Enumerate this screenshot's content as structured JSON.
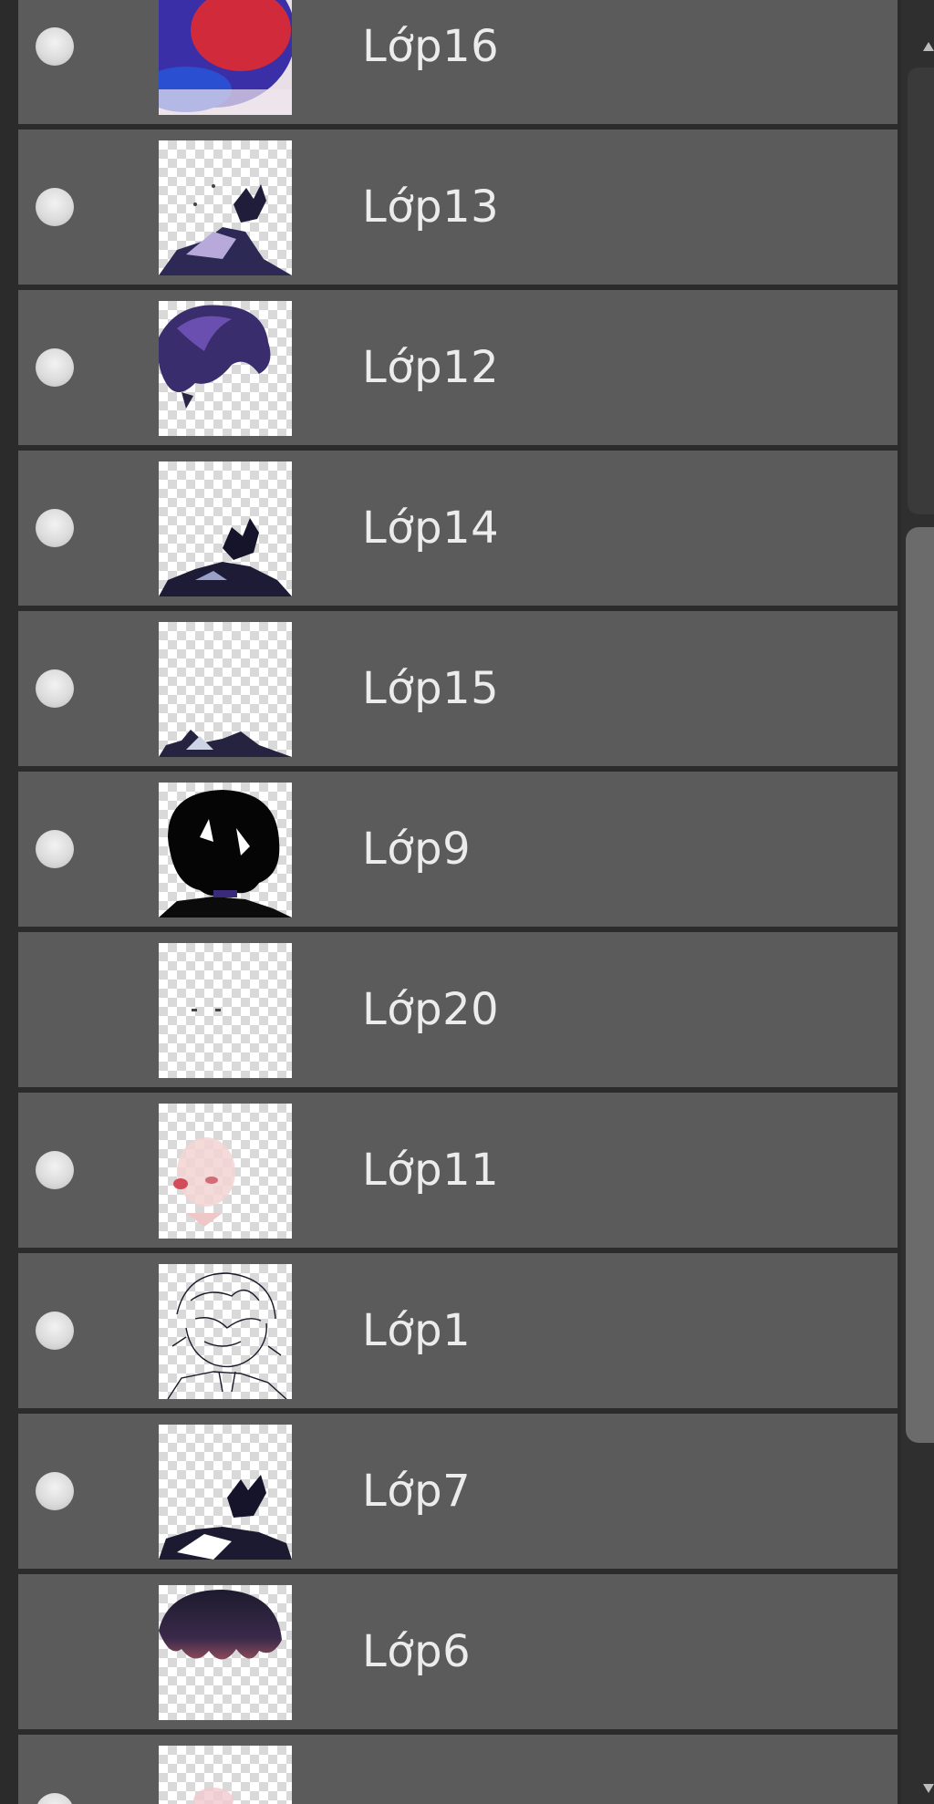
{
  "layers": [
    {
      "name": "Lớp16",
      "visible": true
    },
    {
      "name": "Lớp13",
      "visible": true
    },
    {
      "name": "Lớp12",
      "visible": true
    },
    {
      "name": "Lớp14",
      "visible": true
    },
    {
      "name": "Lớp15",
      "visible": true
    },
    {
      "name": "Lớp9",
      "visible": true
    },
    {
      "name": "Lớp20",
      "visible": false
    },
    {
      "name": "Lớp11",
      "visible": true
    },
    {
      "name": "Lớp1",
      "visible": true
    },
    {
      "name": "Lớp7",
      "visible": true
    },
    {
      "name": "Lớp6",
      "visible": false
    },
    {
      "name": "",
      "visible": true
    }
  ],
  "colors": {
    "panel_background": "#2b2b2b",
    "row_background": "#5b5b5b",
    "text": "#ececec",
    "visibility_dot": "#dcdcdc",
    "scrollbar_thumb": "#6b6b6b"
  },
  "icons": {
    "visibility": "visibility-dot-icon",
    "scroll_up": "triangle-up-icon",
    "scroll_down": "triangle-down-icon"
  }
}
